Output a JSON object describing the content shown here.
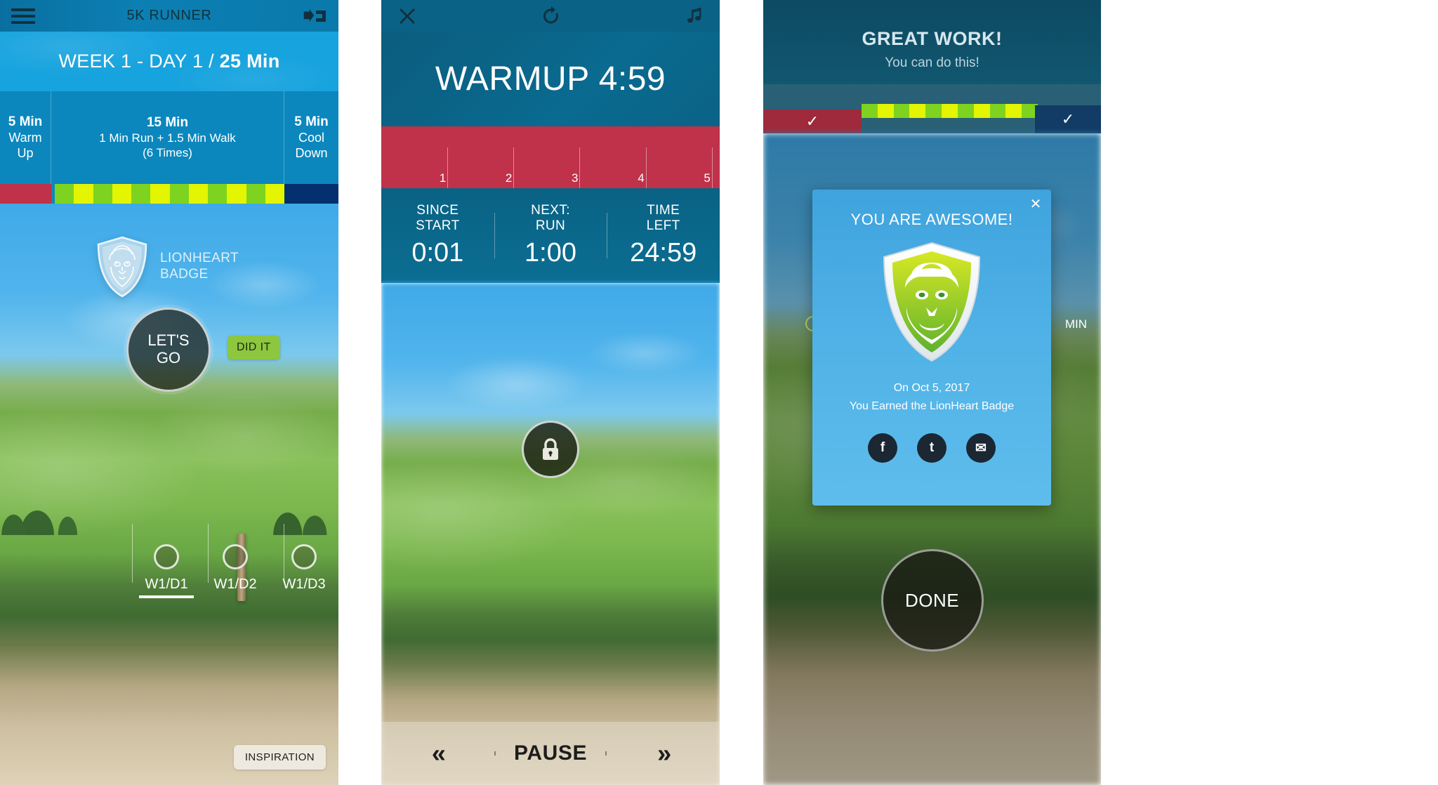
{
  "panel1": {
    "header": {
      "title": "5K RUNNER",
      "menu_icon": "hamburger-menu-icon",
      "expand_icon": "collapse-arrows-icon"
    },
    "day_bar": {
      "prefix": "WEEK 1 - DAY 1 / ",
      "duration": "25 Min"
    },
    "segments": [
      {
        "duration": "5 Min",
        "label": "Warm\nUp",
        "color": "#c0314a"
      },
      {
        "duration": "15 Min",
        "label": "1 Min Run + 1.5 Min Walk\n(6 Times)",
        "color": "#c6e000"
      },
      {
        "duration": "5 Min",
        "label": "Cool\nDown",
        "color": "#04306f"
      }
    ],
    "badge": {
      "name": "LIONHEART\nBADGE",
      "icon": "lion-shield-badge-icon"
    },
    "primary_button": "LET'S\nGO",
    "did_it_button": "DID IT",
    "tabs": [
      {
        "label": "W1/D1",
        "active": true
      },
      {
        "label": "W1/D2",
        "active": false
      },
      {
        "label": "W1/D3",
        "active": false
      }
    ],
    "inspiration_button": "INSPIRATION"
  },
  "panel2": {
    "header": {
      "close_icon": "close-x-icon",
      "refresh_icon": "restart-circular-arrow-icon",
      "music_icon": "music-note-icon"
    },
    "phase_title": "WARMUP 4:59",
    "progress_ticks": [
      "1",
      "2",
      "3",
      "4",
      "5"
    ],
    "stats": [
      {
        "caption": "SINCE\nSTART",
        "value": "0:01"
      },
      {
        "caption": "NEXT:\nRUN",
        "value": "1:00"
      },
      {
        "caption": "TIME\nLEFT",
        "value": "24:59"
      }
    ],
    "lock_button_icon": "lock-icon",
    "footer": {
      "prev": "«",
      "pause": "PAUSE",
      "next": "»"
    }
  },
  "panel3": {
    "header": {
      "title": "GREAT WORK!",
      "subtitle": "You can do this!"
    },
    "check_left_icon": "checkmark-icon",
    "check_right_icon": "checkmark-icon",
    "min_label": "MIN",
    "modal": {
      "close_icon": "close-x-icon",
      "title": "YOU ARE AWESOME!",
      "badge_icon": "lion-shield-badge-icon",
      "date_line": "On Oct 5, 2017",
      "earned_line": "You Earned the LionHeart Badge",
      "share": [
        {
          "name": "facebook-share-button",
          "glyph": "f"
        },
        {
          "name": "twitter-share-button",
          "glyph": "t"
        },
        {
          "name": "email-share-button",
          "glyph": "✉"
        }
      ]
    },
    "done_button": "DONE"
  },
  "colors": {
    "brand_blue": "#0b87bd",
    "header_blue": "#0a6fa0",
    "light_blue": "#17a3de",
    "warmup_red": "#c0314a",
    "interval_yellow": "#e3f500",
    "interval_green": "#7ed321",
    "cooldown_navy": "#04306f",
    "accent_green": "#8dc63f",
    "dark_teal": "#0d4a63"
  }
}
